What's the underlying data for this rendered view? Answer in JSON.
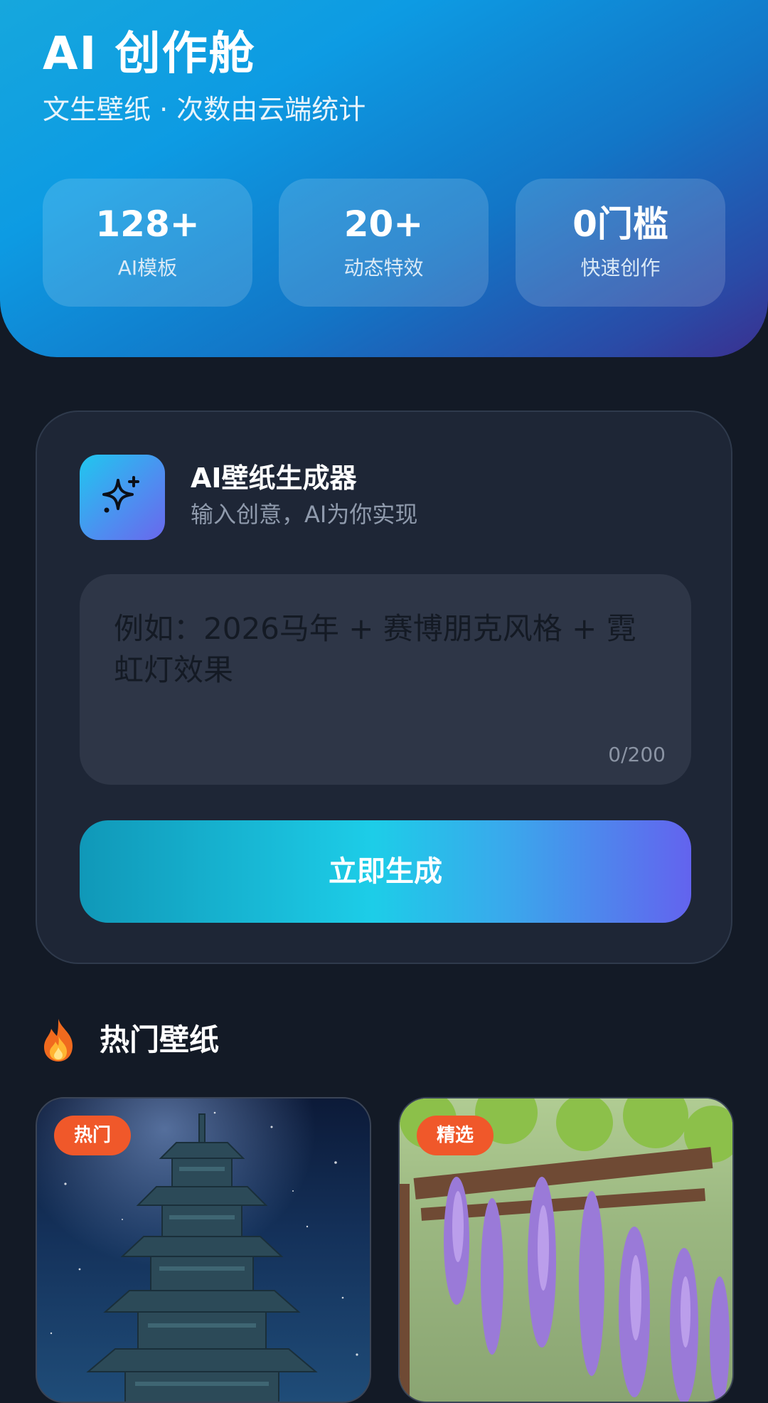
{
  "header": {
    "title": "AI 创作舱",
    "subtitle": "文生壁纸 · 次数由云端统计",
    "stats": [
      {
        "value": "128+",
        "label": "AI模板"
      },
      {
        "value": "20+",
        "label": "动态特效"
      },
      {
        "value": "0门槛",
        "label": "快速创作"
      }
    ]
  },
  "generator": {
    "icon": "sparkles-icon",
    "title": "AI壁纸生成器",
    "subtitle": "输入创意，AI为你实现",
    "prompt": {
      "value": "",
      "placeholder": "例如：2026马年 + 赛博朋克风格 + 霓虹灯效果",
      "counter": "0/200"
    },
    "button_label": "立即生成"
  },
  "hot": {
    "icon": "fire-icon",
    "title": "热门壁纸",
    "items": [
      {
        "badge": "热门",
        "image": "pagoda-night-sky-image"
      },
      {
        "badge": "精选",
        "image": "wisteria-pergola-image"
      }
    ]
  },
  "colors": {
    "badge": "#f0582a",
    "accent_start": "#1dcde8",
    "accent_end": "#6363ee",
    "background": "#131a26"
  }
}
